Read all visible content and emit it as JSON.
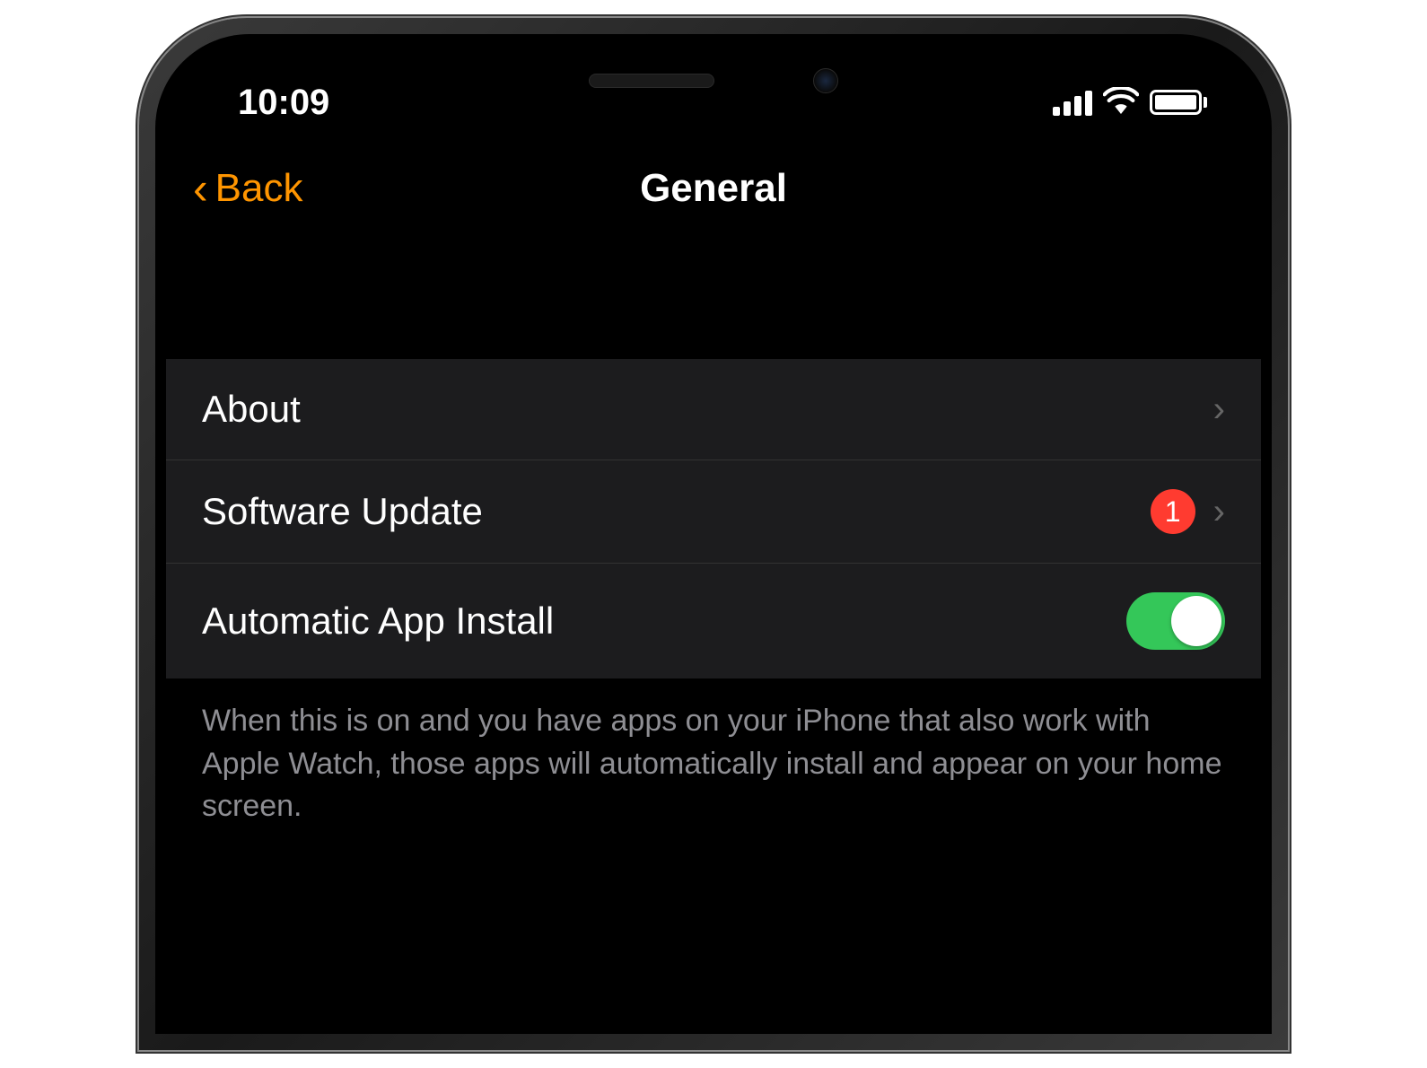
{
  "status_bar": {
    "time": "10:09"
  },
  "nav": {
    "back_label": "Back",
    "title": "General"
  },
  "rows": {
    "about": {
      "label": "About"
    },
    "software_update": {
      "label": "Software Update",
      "badge": "1"
    },
    "auto_install": {
      "label": "Automatic App Install",
      "toggle_on": true
    }
  },
  "footer": "When this is on and you have apps on your iPhone that also work with Apple Watch, those apps will automatically install and appear on your home screen.",
  "colors": {
    "accent": "#ff9500",
    "badge": "#ff3b30",
    "toggle_on": "#34c759",
    "row_bg": "#1c1c1e"
  }
}
